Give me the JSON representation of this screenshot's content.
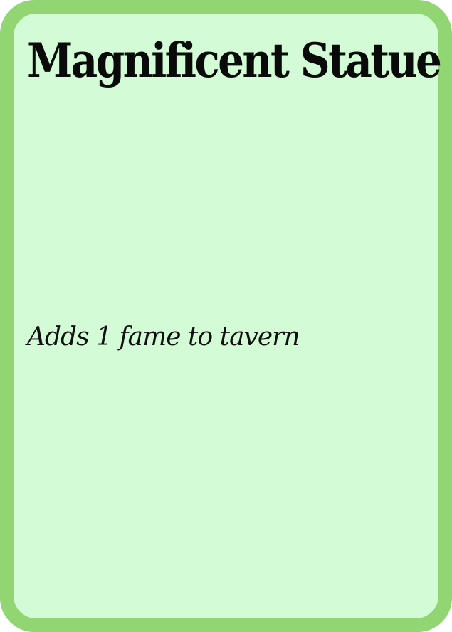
{
  "card": {
    "title": "Magnificent Statue",
    "effect_text": "Adds 1 fame to tavern",
    "colors": {
      "border": "#92d674",
      "face": "#d3fcd6",
      "text": "#0a0a0a"
    }
  }
}
